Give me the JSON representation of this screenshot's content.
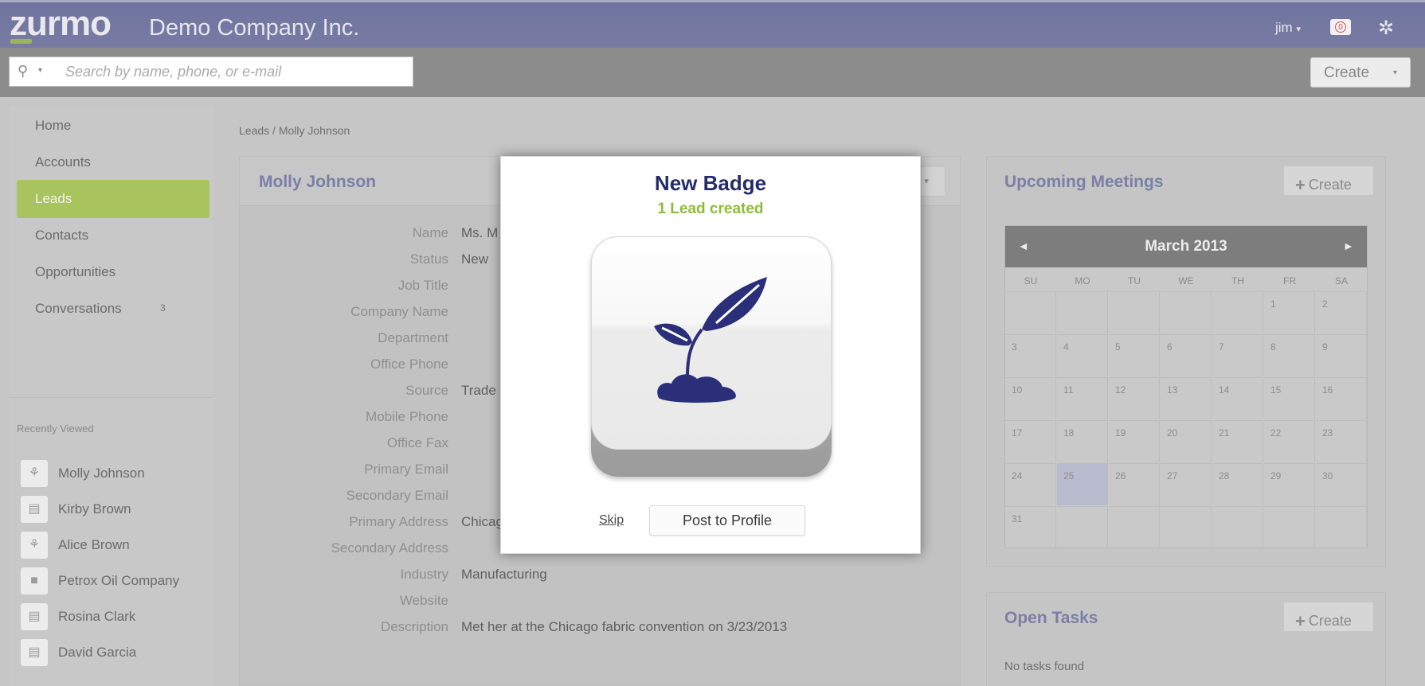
{
  "header": {
    "logo": "zurmo",
    "company": "Demo Company Inc.",
    "user": "jim",
    "user_caret": "▾",
    "notifications": "0",
    "settings_icon": "gear-icon"
  },
  "search": {
    "placeholder": "Search by name, phone, or e-mail",
    "caret": "▾",
    "create_label": "Create",
    "create_caret": "▾"
  },
  "sidebar": {
    "items": [
      {
        "label": "Home"
      },
      {
        "label": "Accounts"
      },
      {
        "label": "Leads",
        "active": true
      },
      {
        "label": "Contacts"
      },
      {
        "label": "Opportunities"
      },
      {
        "label": "Conversations",
        "badge": "3"
      }
    ],
    "recent_title": "Recently Viewed",
    "recent": [
      {
        "label": "Molly Johnson",
        "icon": "lead-icon"
      },
      {
        "label": "Kirby Brown",
        "icon": "contact-card-icon"
      },
      {
        "label": "Alice Brown",
        "icon": "lead-icon"
      },
      {
        "label": "Petrox Oil Company",
        "icon": "folder-icon"
      },
      {
        "label": "Rosina Clark",
        "icon": "contact-card-icon"
      },
      {
        "label": "David Garcia",
        "icon": "contact-card-icon"
      }
    ]
  },
  "breadcrumb": "Leads / Molly Johnson",
  "lead": {
    "name": "Molly Johnson",
    "fields": [
      {
        "label": "Name",
        "value": "Ms. M"
      },
      {
        "label": "Status",
        "value": "New"
      },
      {
        "label": "Job Title",
        "value": ""
      },
      {
        "label": "Company Name",
        "value": ""
      },
      {
        "label": "Department",
        "value": ""
      },
      {
        "label": "Office Phone",
        "value": ""
      },
      {
        "label": "Source",
        "value": "Trade"
      },
      {
        "label": "Mobile Phone",
        "value": ""
      },
      {
        "label": "Office Fax",
        "value": ""
      },
      {
        "label": "Primary Email",
        "value": ""
      },
      {
        "label": "Secondary Email",
        "value": ""
      },
      {
        "label": "Primary Address",
        "value": "Chicago   📍 map"
      },
      {
        "label": "Secondary Address",
        "value": ""
      },
      {
        "label": "Industry",
        "value": "Manufacturing"
      },
      {
        "label": "Website",
        "value": ""
      },
      {
        "label": "Description",
        "value": "Met her at the Chicago fabric convention on 3/23/2013"
      }
    ]
  },
  "meetings": {
    "title": "Upcoming Meetings",
    "create_label": "Create",
    "calendar": {
      "month": "March 2013",
      "prev": "◄",
      "next": "►",
      "dow": [
        "SU",
        "MO",
        "TU",
        "WE",
        "TH",
        "FR",
        "SA"
      ],
      "days": [
        "",
        "",
        "",
        "",
        "",
        "1",
        "2",
        "3",
        "4",
        "5",
        "6",
        "7",
        "8",
        "9",
        "10",
        "11",
        "12",
        "13",
        "14",
        "15",
        "16",
        "17",
        "18",
        "19",
        "20",
        "21",
        "22",
        "23",
        "24",
        "25",
        "26",
        "27",
        "28",
        "29",
        "30",
        "31",
        "",
        "",
        "",
        "",
        "",
        ""
      ],
      "today": "25"
    }
  },
  "tasks": {
    "title": "Open Tasks",
    "create_label": "Create",
    "empty": "No tasks found"
  },
  "modal": {
    "title": "New Badge",
    "subtitle": "1 Lead created",
    "badge_icon": "seedling-icon",
    "skip_label": "Skip",
    "post_label": "Post to Profile"
  }
}
